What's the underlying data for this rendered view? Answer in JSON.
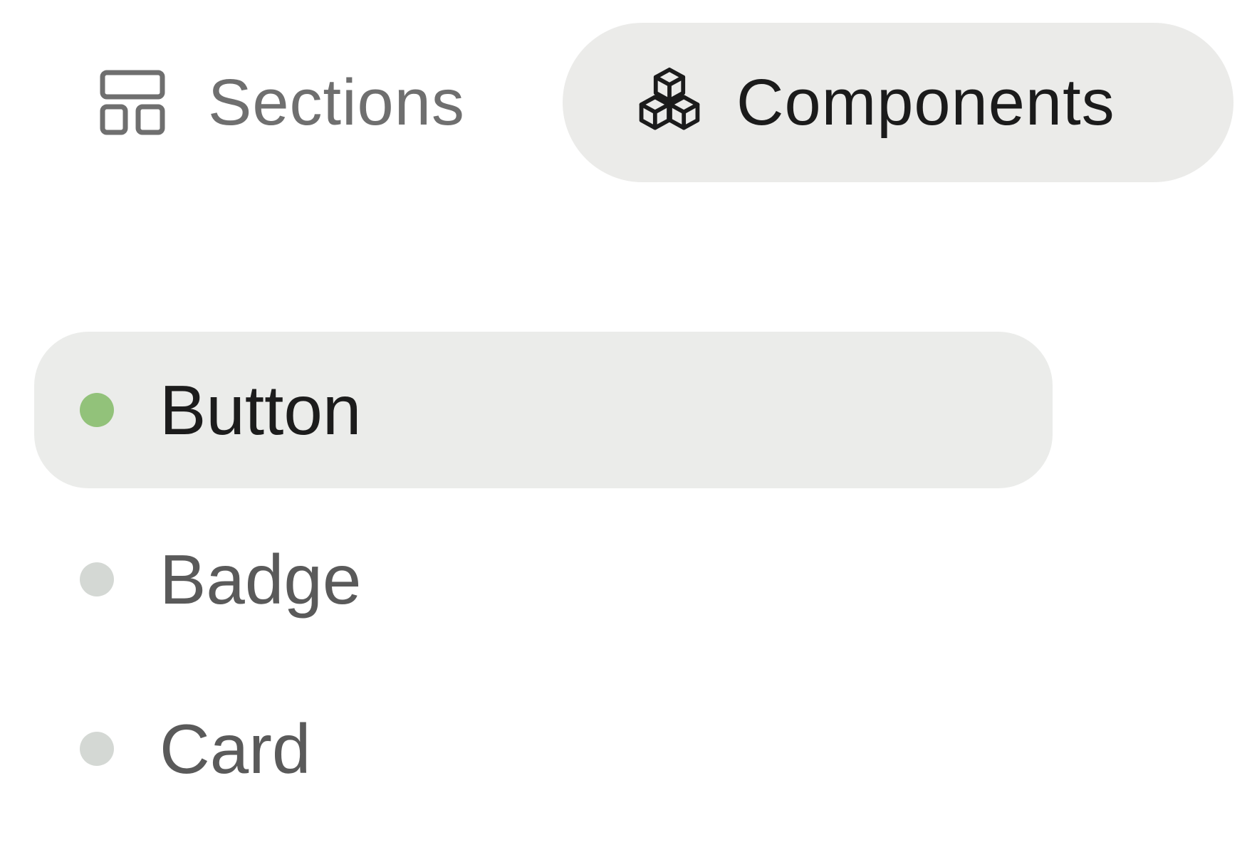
{
  "tabs": {
    "sections": {
      "label": "Sections",
      "icon": "layout-grid-icon"
    },
    "components": {
      "label": "Components",
      "icon": "cubes-icon",
      "selected": true
    }
  },
  "components_list": {
    "items": [
      {
        "label": "Button",
        "active": true,
        "dot_color": "#92c27a"
      },
      {
        "label": "Badge",
        "active": false,
        "dot_color": "#d4d8d4"
      },
      {
        "label": "Card",
        "active": false,
        "dot_color": "#d4d8d4"
      }
    ]
  }
}
